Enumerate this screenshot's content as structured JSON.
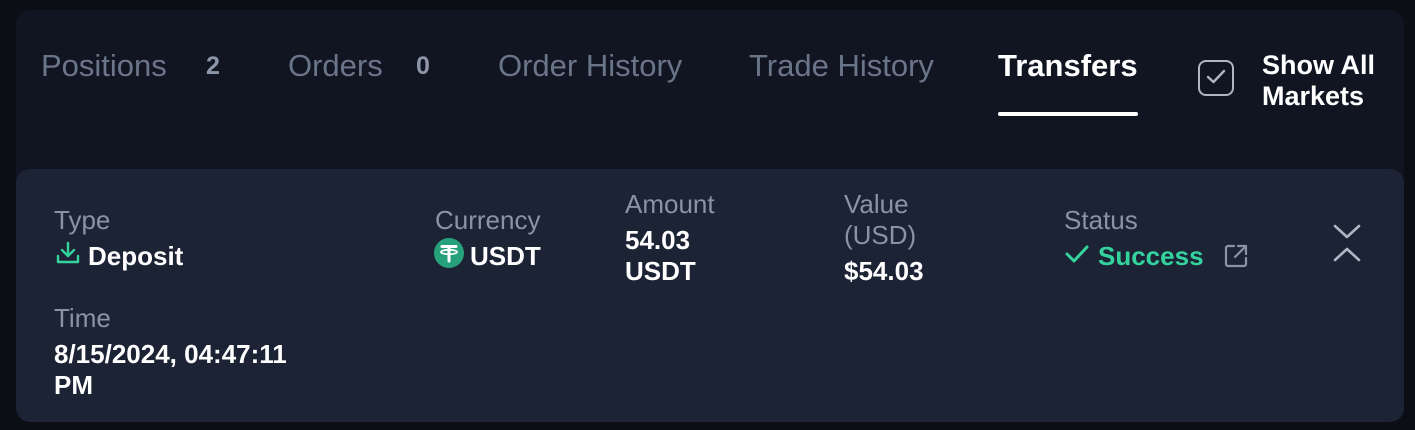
{
  "tabs": {
    "positions": {
      "label": "Positions",
      "count": "2"
    },
    "orders": {
      "label": "Orders",
      "count": "0"
    },
    "order_history": {
      "label": "Order History"
    },
    "trade_history": {
      "label": "Trade History"
    },
    "transfers": {
      "label": "Transfers"
    },
    "active": "transfers"
  },
  "show_all": {
    "label_line1": "Show All",
    "label_line2": "Markets",
    "checked": true
  },
  "transfer": {
    "type_label": "Type",
    "type_value": "Deposit",
    "type_icon": "download-icon",
    "currency_label": "Currency",
    "currency_value": "USDT",
    "currency_icon": "tether-icon",
    "amount_label": "Amount",
    "amount_value_line1": "54.03",
    "amount_value_line2": "USDT",
    "value_label_line1": "Value",
    "value_label_line2": "(USD)",
    "value_value": "$54.03",
    "status_label": "Status",
    "status_value": "Success",
    "status_icon": "checkmark-icon",
    "time_label": "Time",
    "time_value_line1": "8/15/2024, 04:47:11",
    "time_value_line2": "PM"
  },
  "colors": {
    "background": "#0b0e15",
    "panel": "#111522",
    "card": "#1c2335",
    "success": "#34d39e",
    "tether": "#26a17b",
    "muted_text": "#8a93a6"
  }
}
